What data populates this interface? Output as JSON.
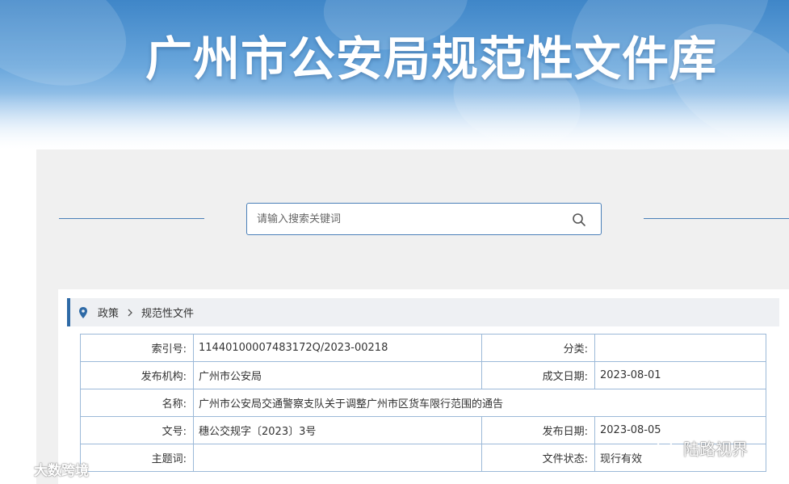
{
  "banner": {
    "title": "广州市公安局规范性文件库"
  },
  "search": {
    "placeholder": "请输入搜索关键词"
  },
  "breadcrumb": {
    "items": [
      "政策",
      "规范性文件"
    ]
  },
  "document_info": {
    "rows": [
      {
        "label1": "索引号:",
        "value1": "11440100007483172Q/2023-00218",
        "label2": "分类:",
        "value2": ""
      },
      {
        "label1": "发布机构:",
        "value1": "广州市公安局",
        "label2": "成文日期:",
        "value2": "2023-08-01"
      },
      {
        "label1": "名称:",
        "value1": "广州市公安局交通警察支队关于调整广州市区货车限行范围的通告"
      },
      {
        "label1": "文号:",
        "value1": "穗公交规字〔2023〕3号",
        "label2": "发布日期:",
        "value2": "2023-08-05"
      },
      {
        "label1": "主题词:",
        "value1": "",
        "label2": "文件状态:",
        "value2": "现行有效"
      }
    ]
  },
  "watermarks": {
    "left": "大数跨境",
    "right": "陆路视界"
  },
  "colors": {
    "accent": "#2e6aa6",
    "border": "#9cb9d8",
    "banner_top": "#3f86c8"
  }
}
